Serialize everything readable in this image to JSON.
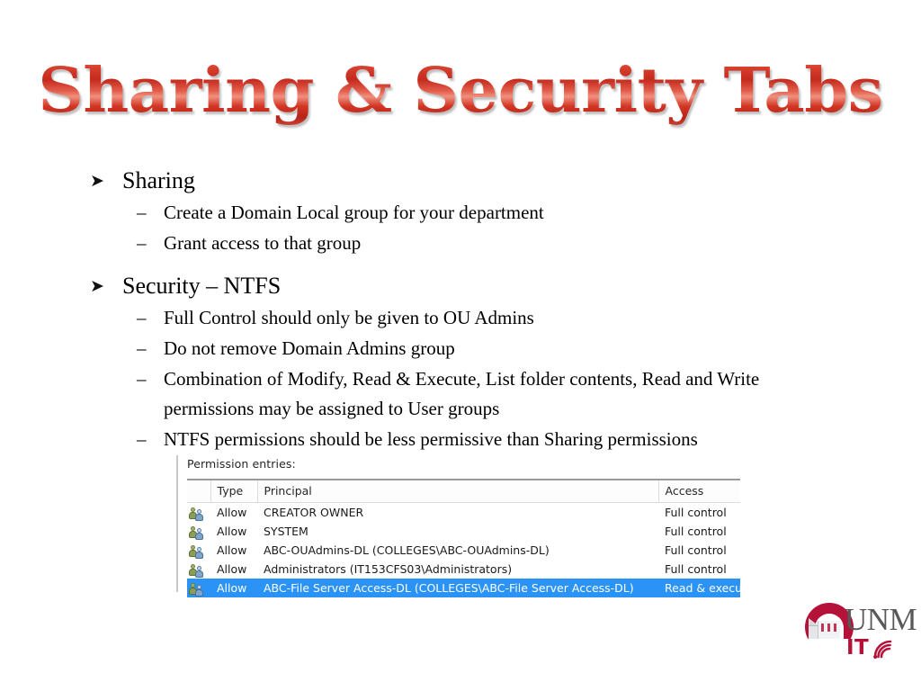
{
  "slide": {
    "title": "Sharing & Security Tabs",
    "title_color": "#c42a1d",
    "background": "#ffffff"
  },
  "bullets": [
    {
      "marker": "➤",
      "text": "Sharing",
      "children": [
        {
          "marker": "–",
          "text": "Create a Domain Local group for your department"
        },
        {
          "marker": "–",
          "text": "Grant access to that group"
        }
      ]
    },
    {
      "marker": "➤",
      "text": "Security – NTFS",
      "children": [
        {
          "marker": "–",
          "text": "Full Control should only be given to OU Admins"
        },
        {
          "marker": "–",
          "text": "Do not remove Domain Admins group"
        },
        {
          "marker": "–",
          "text": "Combination of Modify, Read & Execute, List folder contents, Read and Write permissions may be assigned to User groups"
        },
        {
          "marker": "–",
          "text": "NTFS permissions should be less permissive than Sharing permissions"
        }
      ]
    }
  ],
  "permissions_dialog": {
    "label": "Permission entries:",
    "columns": [
      "",
      "Type",
      "Principal",
      "Access"
    ],
    "selection_color": "#2a93f5",
    "rows": [
      {
        "icon": "group-icon",
        "type": "Allow",
        "principal": "CREATOR OWNER",
        "access": "Full control",
        "selected": false
      },
      {
        "icon": "group-icon",
        "type": "Allow",
        "principal": "SYSTEM",
        "access": "Full control",
        "selected": false
      },
      {
        "icon": "group-icon",
        "type": "Allow",
        "principal": "ABC-OUAdmins-DL (COLLEGES\\ABC-OUAdmins-DL)",
        "access": "Full control",
        "selected": false
      },
      {
        "icon": "group-icon",
        "type": "Allow",
        "principal": "Administrators (IT153CFS03\\Administrators)",
        "access": "Full control",
        "selected": false
      },
      {
        "icon": "group-icon",
        "type": "Allow",
        "principal": "ABC-File Server Access-DL (COLLEGES\\ABC-File Server Access-DL)",
        "access": "Read & execute",
        "selected": true
      }
    ]
  },
  "logo": {
    "wordmark": "UNM",
    "sub": "IT",
    "mark_color": "#b5123a",
    "wordmark_color": "#58595b",
    "icon": "wifi-fan-icon"
  }
}
